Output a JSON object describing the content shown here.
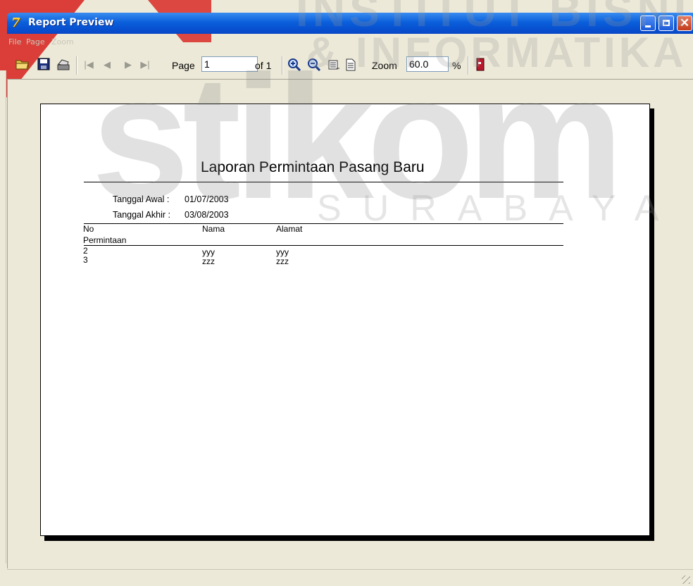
{
  "window": {
    "title": "Report Preview",
    "logo_glyph": "7",
    "minimize_icon": "minimize-icon",
    "maximize_icon": "maximize-icon",
    "close_glyph": "✕"
  },
  "menu": [
    "File",
    "Page",
    "Zoom"
  ],
  "toolbar": {
    "page_label": "Page",
    "page_value": "1",
    "of_label": "of 1",
    "zoom_label": "Zoom",
    "zoom_value": "60.0",
    "percent_label": "%",
    "icons": [
      "open-icon",
      "save-icon",
      "print-icon",
      "first-page-icon",
      "prev-page-icon",
      "next-page-icon",
      "last-page-icon",
      "zoom-in-icon",
      "zoom-out-icon",
      "page-width-icon",
      "whole-page-icon",
      "exit-icon"
    ]
  },
  "report": {
    "title": "Laporan Permintaan Pasang Baru",
    "start_label": "Tanggal Awal :",
    "start_value": "01/07/2003",
    "end_label": "Tanggal Akhir :",
    "end_value": "03/08/2003",
    "columns": [
      "No Permintaan",
      "Nama",
      "Alamat"
    ],
    "col_no_line1": "No",
    "col_no_line2": "Permintaan",
    "rows": [
      {
        "no": "2",
        "nama": "yyy",
        "alamat": "yyy"
      },
      {
        "no": "3",
        "nama": "zzz",
        "alamat": "zzz"
      }
    ]
  },
  "watermark": {
    "line1": "INSTITUT BISNIS",
    "line2": "& INFORMATIKA",
    "logo": "stikom",
    "city": "SURABAYA"
  },
  "colors": {
    "titlebar": "#0a5fdb",
    "background": "#ece9d8",
    "watermark_red": "#d92b27"
  }
}
